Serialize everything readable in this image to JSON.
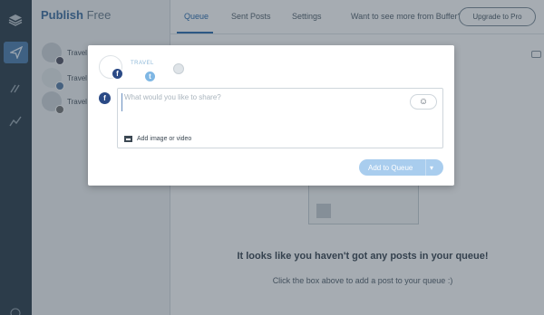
{
  "app": {
    "brand": "Publish",
    "plan": "Free"
  },
  "rail": {
    "icons": [
      "layers-icon",
      "send-icon",
      "calendar-icon",
      "analytics-icon",
      "help-icon"
    ]
  },
  "sidebar": {
    "profiles": [
      {
        "name": "Travel",
        "network": "facebook"
      },
      {
        "name": "Travel",
        "network": "twitter"
      },
      {
        "name": "Travel",
        "network": "google"
      }
    ]
  },
  "nav": {
    "tabs": [
      {
        "label": "Queue"
      },
      {
        "label": "Sent Posts"
      },
      {
        "label": "Settings"
      }
    ],
    "promo": "Want to see more from Buffer?",
    "upgrade_label": "Upgrade to Pro"
  },
  "queue": {
    "empty_title": "It looks like you haven't got any posts in your queue!",
    "empty_subtitle": "Click the box above to add a post to your queue :)"
  },
  "composer": {
    "twitter_wordmark": "TRAVEL",
    "placeholder": "What would you like to share?",
    "emoji_glyph": "☺",
    "media_label": "Add image or video",
    "submit_label": "Add to Queue",
    "submit_chevron": "▾",
    "fb_glyph": "f",
    "tw_glyph": "t"
  },
  "colors": {
    "accent": "#2f6fb0",
    "facebook": "#2b4a86",
    "twitter": "#7fb7e4",
    "submit_disabled": "#a9cdee"
  }
}
